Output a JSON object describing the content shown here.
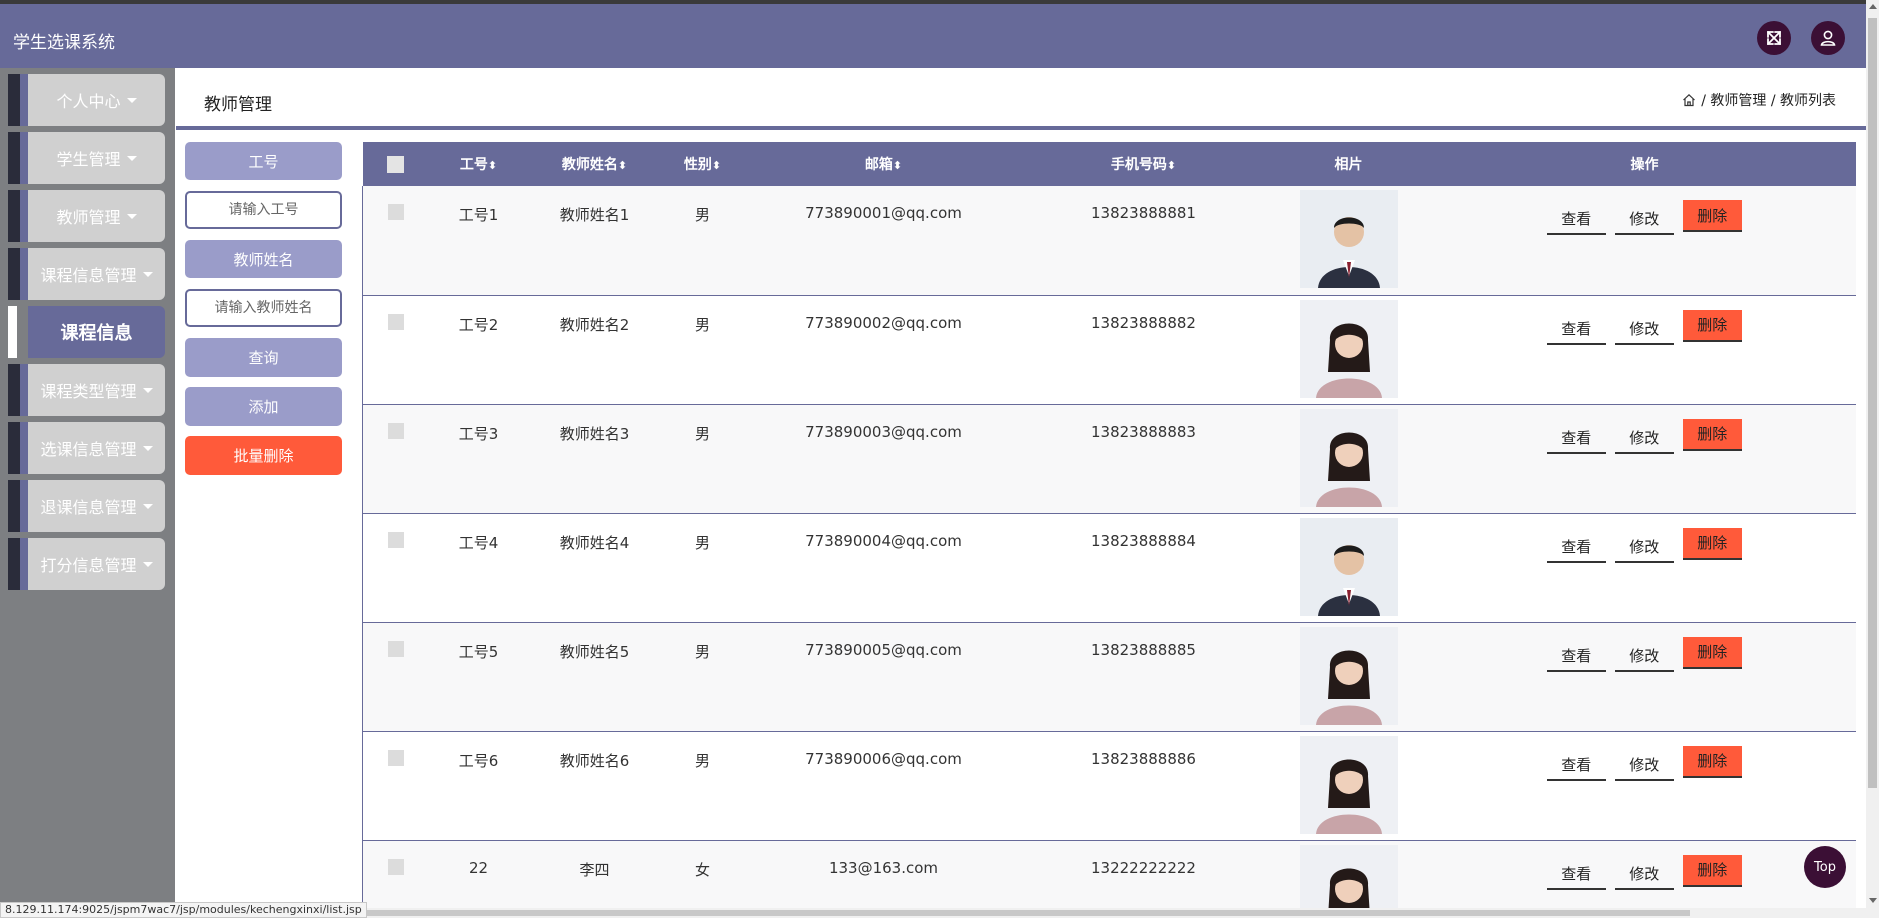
{
  "header": {
    "app_title": "学生选课系统",
    "fullscreen_icon": "expand-icon",
    "user_icon": "user-icon"
  },
  "sidebar": {
    "items": [
      {
        "label": "个人中心",
        "dropdown": true
      },
      {
        "label": "学生管理",
        "dropdown": true
      },
      {
        "label": "教师管理",
        "dropdown": true
      },
      {
        "label": "课程信息管理",
        "dropdown": true
      },
      {
        "label": "课程信息",
        "dropdown": false,
        "active": true
      },
      {
        "label": "课程类型管理",
        "dropdown": true
      },
      {
        "label": "选课信息管理",
        "dropdown": true
      },
      {
        "label": "退课信息管理",
        "dropdown": true
      },
      {
        "label": "打分信息管理",
        "dropdown": true
      }
    ]
  },
  "breadcrumb": {
    "title": "教师管理",
    "home_icon": "home-icon",
    "path": "/ 教师管理 / 教师列表"
  },
  "search": {
    "id_label": "工号",
    "id_placeholder": "请输入工号",
    "name_label": "教师姓名",
    "name_placeholder": "请输入教师姓名",
    "query_button": "查询",
    "add_button": "添加",
    "batch_delete_button": "批量删除"
  },
  "table": {
    "columns": [
      "工号",
      "教师姓名",
      "性别",
      "邮箱",
      "手机号码",
      "相片",
      "操作"
    ],
    "sort_mark": "⬍",
    "actions": {
      "view": "查看",
      "edit": "修改",
      "delete": "删除"
    },
    "rows": [
      {
        "id": "工号1",
        "name": "教师姓名1",
        "gender": "男",
        "email": "773890001@qq.com",
        "phone": "13823888881",
        "photo": "male-teacher-photo"
      },
      {
        "id": "工号2",
        "name": "教师姓名2",
        "gender": "男",
        "email": "773890002@qq.com",
        "phone": "13823888882",
        "photo": "female-teacher-photo"
      },
      {
        "id": "工号3",
        "name": "教师姓名3",
        "gender": "男",
        "email": "773890003@qq.com",
        "phone": "13823888883",
        "photo": "female-teacher-photo"
      },
      {
        "id": "工号4",
        "name": "教师姓名4",
        "gender": "男",
        "email": "773890004@qq.com",
        "phone": "13823888884",
        "photo": "male-teacher-photo"
      },
      {
        "id": "工号5",
        "name": "教师姓名5",
        "gender": "男",
        "email": "773890005@qq.com",
        "phone": "13823888885",
        "photo": "female-teacher-photo"
      },
      {
        "id": "工号6",
        "name": "教师姓名6",
        "gender": "男",
        "email": "773890006@qq.com",
        "phone": "13823888886",
        "photo": "female-teacher-photo"
      },
      {
        "id": "22",
        "name": "李四",
        "gender": "女",
        "email": "133@163.com",
        "phone": "13222222222",
        "photo": "female-teacher-photo"
      }
    ]
  },
  "back_to_top": "Top",
  "status_url": "8.129.11.174:9025/jspm7wac7/jsp/modules/kechengxinxi/list.jsp",
  "colors": {
    "primary": "#676a99",
    "light_primary": "#9a9cc9",
    "danger": "#ff5a3a",
    "dark_accent": "#3b0f35"
  }
}
